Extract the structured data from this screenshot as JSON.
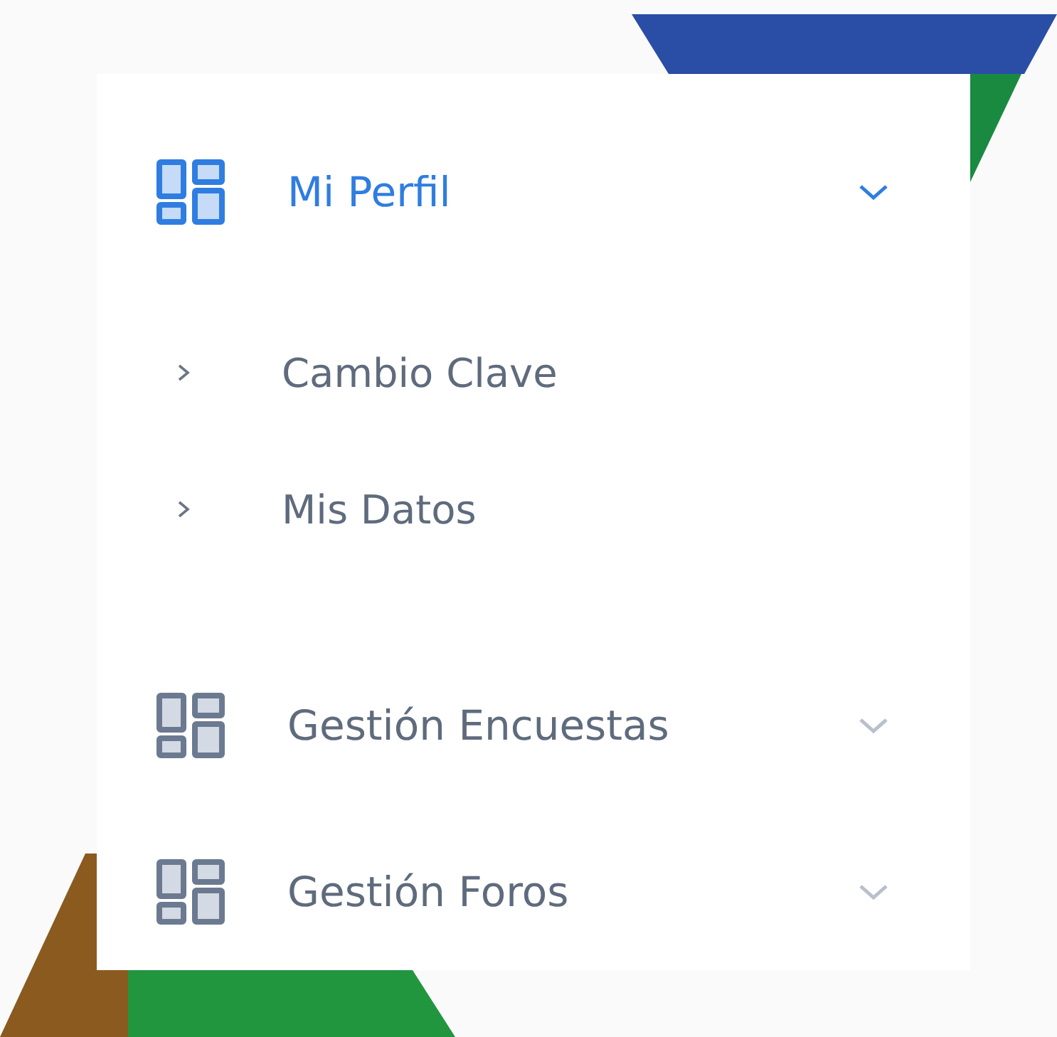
{
  "menu": [
    {
      "label": "Mi Perfil",
      "selected": true,
      "expanded": true,
      "children": [
        {
          "label": "Cambio Clave"
        },
        {
          "label": "Mis Datos"
        }
      ]
    },
    {
      "label": "Gestión Encuestas",
      "selected": false,
      "expanded": false
    },
    {
      "label": "Gestión Foros",
      "selected": false,
      "expanded": false
    }
  ]
}
